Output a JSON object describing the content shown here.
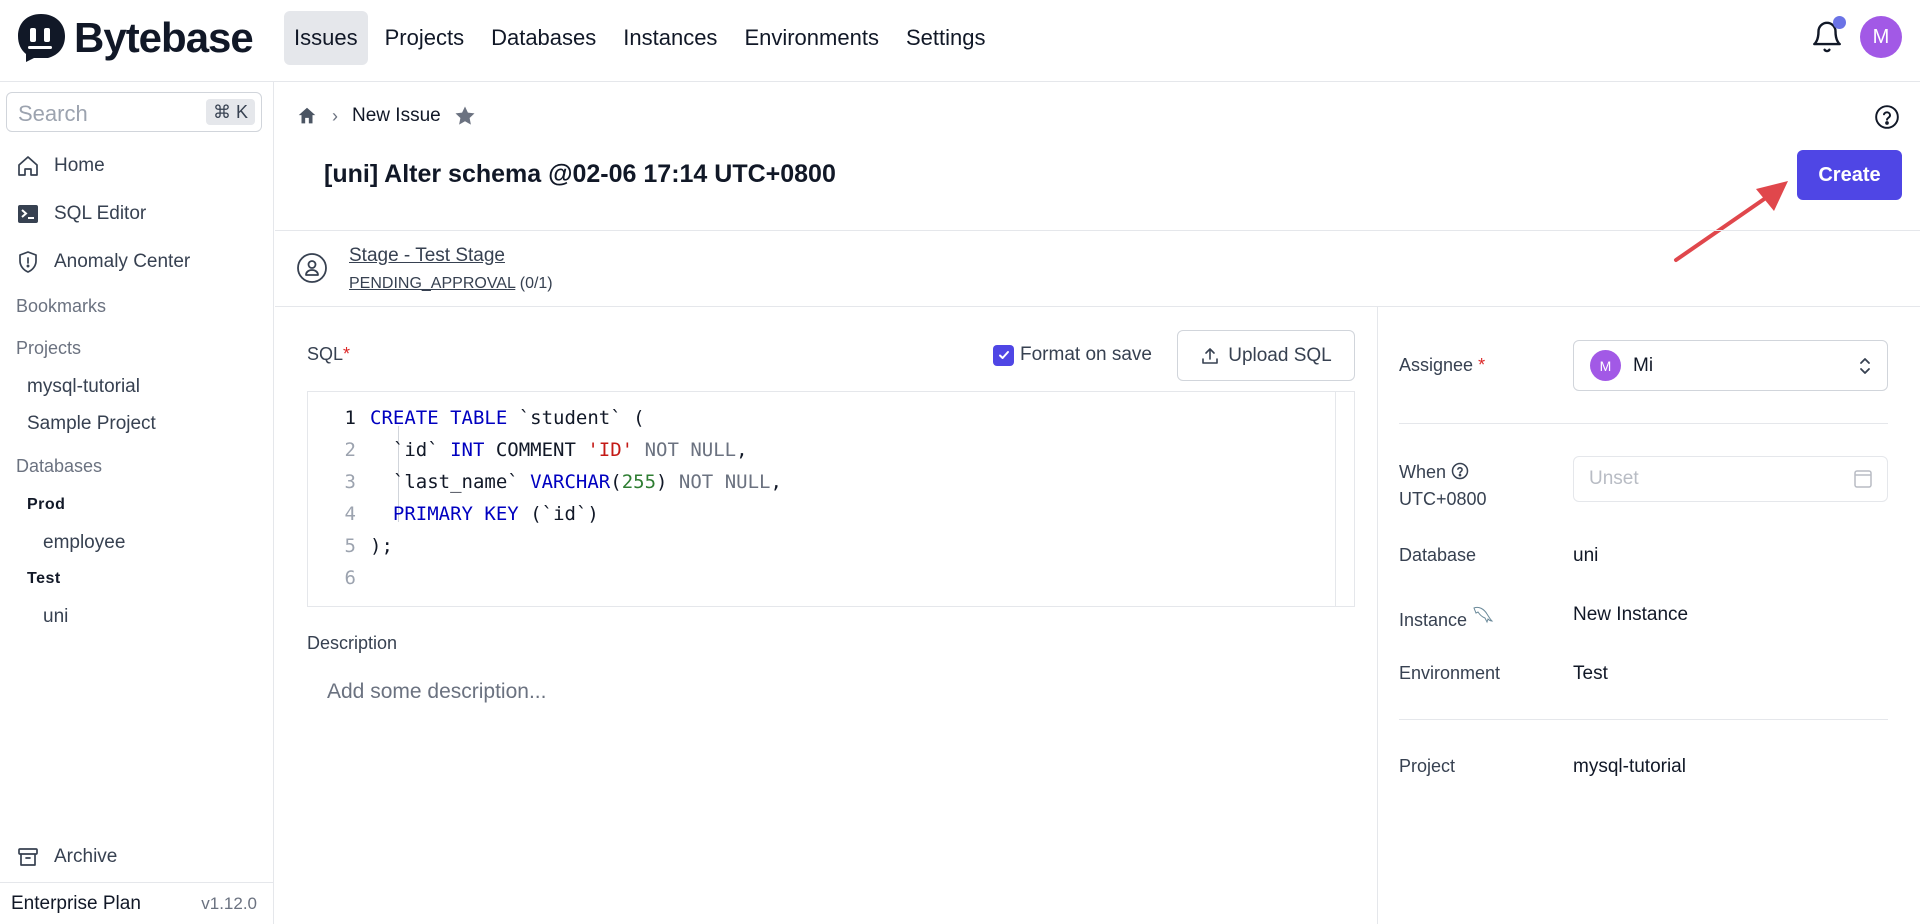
{
  "app": {
    "name": "Bytebase"
  },
  "nav": {
    "items": [
      {
        "label": "Issues",
        "active": true
      },
      {
        "label": "Projects",
        "active": false
      },
      {
        "label": "Databases",
        "active": false
      },
      {
        "label": "Instances",
        "active": false
      },
      {
        "label": "Environments",
        "active": false
      },
      {
        "label": "Settings",
        "active": false
      }
    ],
    "notification_icon": "bell-icon",
    "has_unread": true,
    "user_initial": "M",
    "colors": {
      "avatar": "#a259e6",
      "dot": "#6b73e6"
    }
  },
  "sidebar": {
    "search_placeholder": "Search",
    "search_shortcut": "⌘ K",
    "items": [
      {
        "label": "Home",
        "icon": "home-icon"
      },
      {
        "label": "SQL Editor",
        "icon": "terminal-icon"
      },
      {
        "label": "Anomaly Center",
        "icon": "shield-icon"
      }
    ],
    "bookmarks_heading": "Bookmarks",
    "projects_heading": "Projects",
    "projects": [
      "mysql-tutorial",
      "Sample Project"
    ],
    "databases_heading": "Databases",
    "environments": [
      {
        "name": "Prod",
        "databases": [
          "employee"
        ]
      },
      {
        "name": "Test",
        "databases": [
          "uni"
        ]
      }
    ],
    "archive_label": "Archive",
    "plan": "Enterprise Plan",
    "version": "v1.12.0"
  },
  "breadcrumb": {
    "current": "New Issue"
  },
  "issue": {
    "title": "[uni] Alter schema @02-06 17:14 UTC+0800",
    "create_label": "Create",
    "stage_link": "Stage - Test Stage",
    "stage_status": "PENDING_APPROVAL",
    "stage_count": "(0/1)"
  },
  "sql": {
    "label": "SQL",
    "required": "*",
    "format_on_save_label": "Format on save",
    "format_on_save": true,
    "upload_label": "Upload SQL",
    "line_numbers": [
      "1",
      "2",
      "3",
      "4",
      "5",
      "6"
    ],
    "lines": [
      "CREATE TABLE `student` (",
      "  `id` INT COMMENT 'ID' NOT NULL,",
      "  `last_name` VARCHAR(255) NOT NULL,",
      "  PRIMARY KEY (`id`)",
      ");",
      ""
    ]
  },
  "description": {
    "label": "Description",
    "placeholder": "Add some description..."
  },
  "details": {
    "assignee_label": "Assignee",
    "assignee_required": "*",
    "assignee_initial": "M",
    "assignee_name": "Mi",
    "when_label": "When",
    "when_tz": "UTC+0800",
    "when_placeholder": "Unset",
    "database_label": "Database",
    "database_value": "uni",
    "instance_label": "Instance",
    "instance_value": "New Instance",
    "environment_label": "Environment",
    "environment_value": "Test",
    "project_label": "Project",
    "project_value": "mysql-tutorial"
  },
  "colors": {
    "primary": "#4f46e5",
    "annotation_arrow": "#e0474c",
    "required": "#dc2626"
  }
}
